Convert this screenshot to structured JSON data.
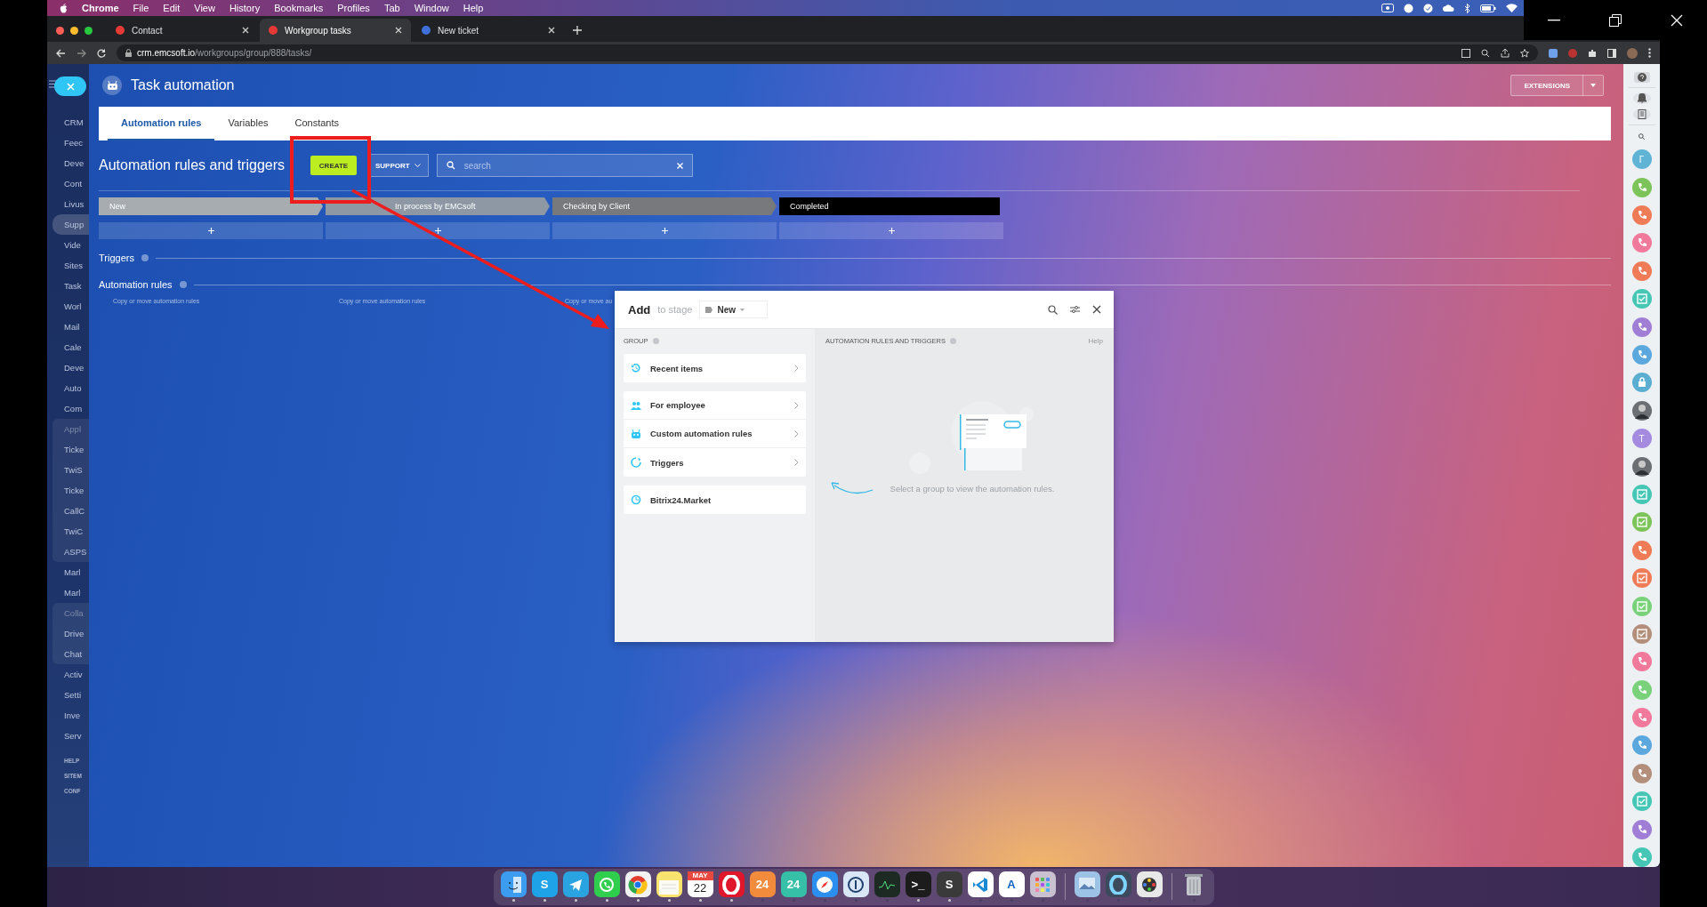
{
  "menu_bar": {
    "app": "Chrome",
    "items": [
      "File",
      "Edit",
      "View",
      "History",
      "Bookmarks",
      "Profiles",
      "Tab",
      "Window",
      "Help"
    ]
  },
  "browser": {
    "tabs": [
      {
        "title": "Contact",
        "selected": false
      },
      {
        "title": "Workgroup tasks",
        "selected": true
      },
      {
        "title": "New ticket",
        "selected": false
      }
    ],
    "url_host": "crm.emcsoft.io",
    "url_path": "/workgroups/group/888/tasks/"
  },
  "left_menu": {
    "items": [
      {
        "kind": "link",
        "label": "CRM",
        "selected": false
      },
      {
        "kind": "link",
        "label": "Feec",
        "selected": false
      },
      {
        "kind": "link",
        "label": "Deve",
        "selected": false
      },
      {
        "kind": "link",
        "label": "Cont",
        "selected": false
      },
      {
        "kind": "link",
        "label": "Livus",
        "selected": false
      },
      {
        "kind": "link",
        "label": "Supp",
        "selected": true
      },
      {
        "kind": "link",
        "label": "Vide",
        "selected": false
      },
      {
        "kind": "link",
        "label": "Sites",
        "selected": false
      },
      {
        "kind": "link",
        "label": "Task",
        "selected": false
      },
      {
        "kind": "link",
        "label": "Worl",
        "selected": false
      },
      {
        "kind": "link",
        "label": "Mail",
        "selected": false
      },
      {
        "kind": "link",
        "label": "Cale",
        "selected": false
      },
      {
        "kind": "link",
        "label": "Deve",
        "selected": false
      },
      {
        "kind": "link",
        "label": "Auto",
        "selected": false
      },
      {
        "kind": "link",
        "label": "Com",
        "selected": false
      },
      {
        "kind": "group",
        "label": "Appl",
        "children": [
          {
            "label": "Ticke",
            "selected": false
          },
          {
            "label": "TwiS",
            "selected": false
          },
          {
            "label": "Ticke",
            "selected": false
          },
          {
            "label": "CallC",
            "selected": false
          },
          {
            "label": "TwiC",
            "selected": false
          },
          {
            "label": "ASPS",
            "selected": false
          }
        ]
      },
      {
        "kind": "link",
        "label": "Marl",
        "selected": false
      },
      {
        "kind": "link",
        "label": "Marl",
        "selected": false
      },
      {
        "kind": "group",
        "label": "Colla",
        "children": [
          {
            "label": "Drive",
            "selected": false
          },
          {
            "label": "Chat",
            "selected": false
          }
        ]
      },
      {
        "kind": "link",
        "label": "Activ",
        "selected": false
      },
      {
        "kind": "link",
        "label": "Setti",
        "selected": false
      },
      {
        "kind": "link",
        "label": "Inve",
        "selected": false
      },
      {
        "kind": "link",
        "label": "Serv",
        "selected": false
      },
      {
        "kind": "footer",
        "label": "HELP"
      },
      {
        "kind": "footer",
        "label": "SITEM"
      },
      {
        "kind": "footer",
        "label": "CONF"
      }
    ]
  },
  "slider": {
    "title": "Task automation",
    "extensions": "EXTENSIONS",
    "tabs": [
      {
        "label": "Automation rules",
        "selected": true
      },
      {
        "label": "Variables",
        "selected": false
      },
      {
        "label": "Constants",
        "selected": false
      }
    ],
    "heading": "Automation rules and triggers",
    "create": "CREATE",
    "support": "SUPPORT",
    "search": {
      "placeholder": "search"
    },
    "stages": [
      {
        "name": "New",
        "color": "#a7acb1"
      },
      {
        "name": "In process by EMCsoft",
        "color": "#8d98a4"
      },
      {
        "name": "Checking by Client",
        "color": "#77797d"
      },
      {
        "name": "Completed",
        "color": "#000000"
      }
    ],
    "triggers": "Triggers",
    "automation_rules": "Automation rules",
    "copy_links": [
      "Copy or move automation rules",
      "Copy or move automation rules",
      "Copy or move au"
    ]
  },
  "dialog": {
    "title": "Add",
    "subtitle": "to stage",
    "stage": "New",
    "group_heading": "GROUP",
    "sections": [
      [
        {
          "label": "Recent items",
          "kind": "history",
          "arrow": true
        }
      ],
      [
        {
          "label": "For employee",
          "kind": "people",
          "arrow": true
        },
        {
          "label": "Custom automation rules",
          "kind": "robot",
          "arrow": true
        },
        {
          "label": "Triggers",
          "kind": "trigger",
          "arrow": true
        }
      ],
      [
        {
          "label": "Bitrix24.Market",
          "kind": "market",
          "arrow": false
        }
      ]
    ],
    "rules_heading": "AUTOMATION RULES AND TRIGGERS",
    "help": "Help",
    "empty_text": "Select a group to view the automation rules."
  },
  "right_bar": {
    "items": [
      {
        "kind": "letter",
        "letter": "Г",
        "color": "#5fb4d6"
      },
      {
        "kind": "phone",
        "color": "#7cc35a"
      },
      {
        "kind": "phone",
        "color": "#ef7b57"
      },
      {
        "kind": "phone",
        "color": "#f1799b"
      },
      {
        "kind": "phone",
        "color": "#ef7b57"
      },
      {
        "kind": "task",
        "color": "#46c7b6"
      },
      {
        "kind": "phone",
        "color": "#a07ed6"
      },
      {
        "kind": "phone",
        "color": "#5aa8de"
      },
      {
        "kind": "lock",
        "color": "#5aaed2"
      },
      {
        "kind": "photo",
        "color": "#6b6f73"
      },
      {
        "kind": "letter",
        "letter": "T",
        "color": "#a58be0"
      },
      {
        "kind": "photo",
        "color": "#6b6f73"
      },
      {
        "kind": "task",
        "color": "#46c7b6"
      },
      {
        "kind": "task",
        "color": "#7cc35a"
      },
      {
        "kind": "phone",
        "color": "#ef7b57"
      },
      {
        "kind": "task",
        "color": "#ef7b57"
      },
      {
        "kind": "task",
        "color": "#79d27a"
      },
      {
        "kind": "task",
        "color": "#b38f7b"
      },
      {
        "kind": "phone",
        "color": "#f1799b"
      },
      {
        "kind": "phone",
        "color": "#79d27a"
      },
      {
        "kind": "phone",
        "color": "#f1799b"
      },
      {
        "kind": "phone",
        "color": "#5aa8de"
      },
      {
        "kind": "phone",
        "color": "#b38f7b"
      },
      {
        "kind": "task",
        "color": "#46c7b6"
      },
      {
        "kind": "phone",
        "color": "#a07ed6"
      },
      {
        "kind": "phone",
        "color": "#46c7b6"
      }
    ]
  },
  "dock": {
    "apps": [
      {
        "kind": "finder",
        "color": "#3b9cf0",
        "running": true
      },
      {
        "kind": "glyph",
        "glyph": "S",
        "color": "#1fa3e8",
        "running": true
      },
      {
        "kind": "plane",
        "color": "#2aa4e0",
        "running": true
      },
      {
        "kind": "phone",
        "color": "#2fcf4d",
        "running": true
      },
      {
        "kind": "chrome",
        "color": "#f2f2f2",
        "running": true
      },
      {
        "kind": "notes",
        "color": "#fbe36f",
        "running": true
      },
      {
        "kind": "calendar",
        "month": "MAY",
        "day": "22",
        "color": "#ffffff",
        "running": true
      },
      {
        "kind": "ring",
        "color": "#e0172b",
        "running": true
      },
      {
        "kind": "glyph",
        "glyph": "24",
        "color": "#f28b3c",
        "running": false
      },
      {
        "kind": "glyph",
        "glyph": "24",
        "color": "#36c0a8",
        "running": false
      },
      {
        "kind": "compass",
        "color": "#2b8ff0",
        "running": false
      },
      {
        "kind": "keyhole",
        "color": "#d9e6f5",
        "running": false
      },
      {
        "kind": "monitor",
        "color": "#1d2a24",
        "running": false
      },
      {
        "kind": "glyph",
        "glyph": ">_",
        "color": "#1c1c1c",
        "running": true
      },
      {
        "kind": "glyph",
        "glyph": "S",
        "color": "#3a3a3a",
        "running": true
      },
      {
        "kind": "code",
        "color": "#ffffff",
        "running": false
      },
      {
        "kind": "glyph",
        "glyph": "A",
        "color": "#ffffff",
        "running": false
      },
      {
        "kind": "grid",
        "color": "#c9c0d0",
        "running": false
      },
      {
        "kind": "separator"
      },
      {
        "kind": "photo",
        "color": "#9cc3e6",
        "running": false
      },
      {
        "kind": "ring",
        "color": "#3b4a5c",
        "running": false
      },
      {
        "kind": "film",
        "color": "#e8e8e8",
        "running": false
      },
      {
        "kind": "separator"
      },
      {
        "kind": "trash",
        "running": false
      }
    ]
  }
}
